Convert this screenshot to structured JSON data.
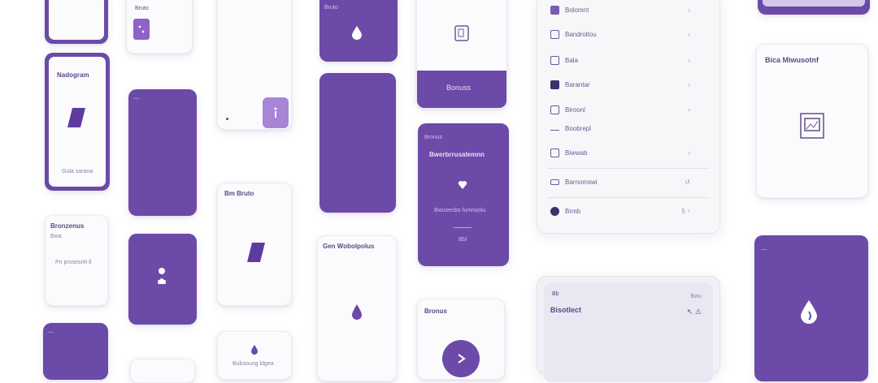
{
  "colors": {
    "purple": "#6b4aa8",
    "light_purple": "#a886d6",
    "white": "#fbfbfd",
    "text": "#5b4a86"
  },
  "cards": {
    "c1_title": "Bruto",
    "c2_title": "Nadogram",
    "c2_footer": "Gula sarana",
    "c3_title": "Bronzenus",
    "c3_sub": "Bwa",
    "c3_line": "Pn prosesnh ll",
    "c4_title": "Bm Bruto",
    "c5_title": "Gen Wobolpolus",
    "c6_button": "Bonuss",
    "c7_title": "Bronus",
    "c7_heading": "Bwerbrrusalemnn",
    "c7_line": "Bwusenbo fumnoolu",
    "c7_small": "Bbl",
    "c8_title": "Bronus",
    "c9_footer": "Bubsoung ldgea",
    "c10_title": "Bica Miwusotnf"
  },
  "settings": {
    "items": [
      {
        "label": "Bolomnt",
        "icon": "card-icon",
        "chevron": "›"
      },
      {
        "label": "Bandroltou",
        "icon": "doc-icon",
        "chevron": "›"
      },
      {
        "label": "Bala",
        "icon": "chart-icon",
        "chevron": "›"
      },
      {
        "label": "Barantar",
        "icon": "square-fill-icon",
        "chevron": "›"
      },
      {
        "label": "Biroonl",
        "icon": "box-icon",
        "chevron": "›"
      },
      {
        "label": "Boobrepl",
        "icon": "list-icon",
        "chevron": ""
      },
      {
        "label": "Biwwab",
        "icon": "grid-icon",
        "chevron": "›"
      },
      {
        "label": "Barnomswi",
        "icon": "key-icon",
        "chevron": "↺"
      },
      {
        "label": "Brmb",
        "icon": "circle-icon",
        "chevron": "5 ↑"
      }
    ]
  },
  "panel2": {
    "tag": "Bb",
    "right": "Bwu",
    "title": "Bisotlect",
    "actions": "↖ ⚠"
  }
}
